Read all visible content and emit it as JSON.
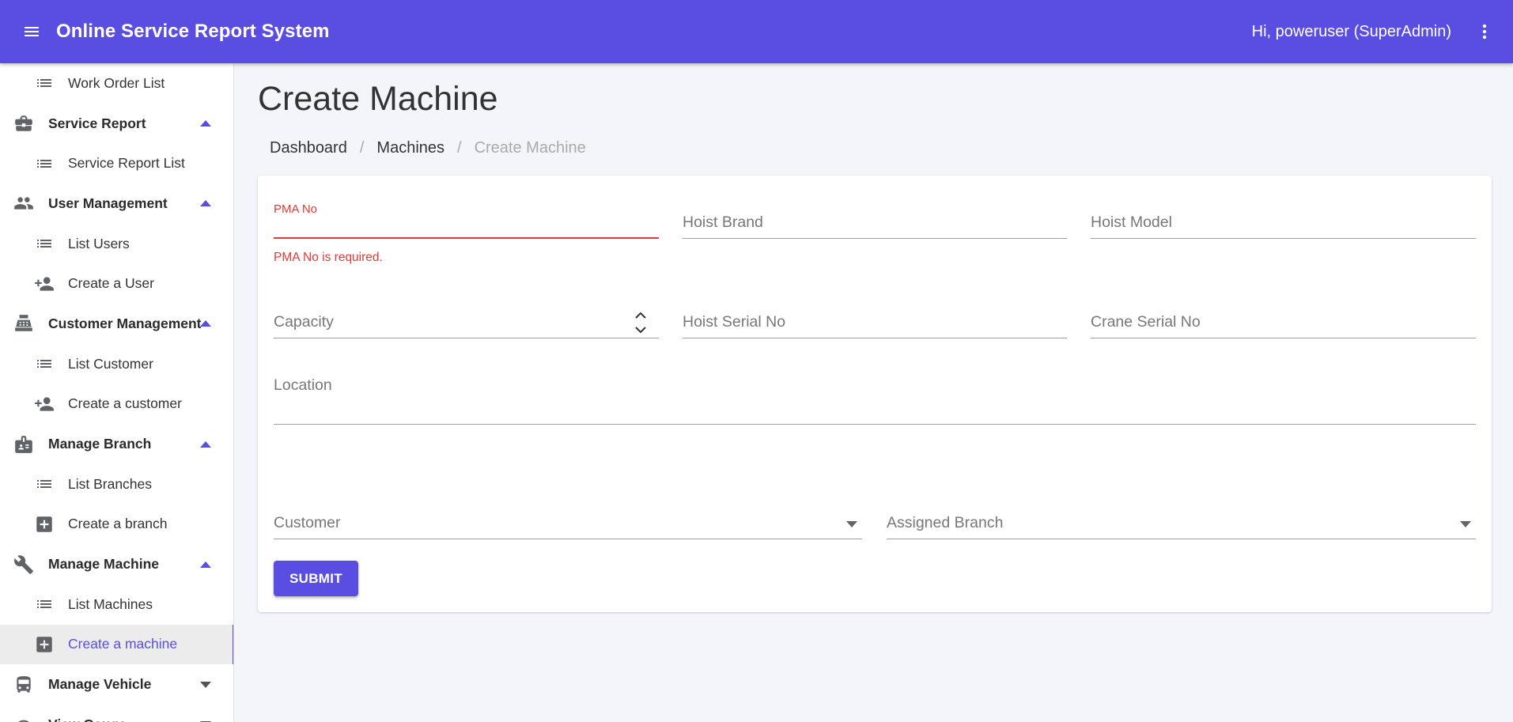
{
  "app": {
    "title": "Online Service Report System",
    "greeting": "Hi, poweruser (SuperAdmin)",
    "accent_color": "#5a4ee2",
    "error_color": "#e53935"
  },
  "sidebar": {
    "items": [
      {
        "type": "sub",
        "label": "Work Order List",
        "icon": "list-icon"
      },
      {
        "type": "group",
        "label": "Service Report",
        "icon": "briefcase-icon",
        "expanded": true
      },
      {
        "type": "sub",
        "label": "Service Report List",
        "icon": "list-icon"
      },
      {
        "type": "group",
        "label": "User Management",
        "icon": "people-icon",
        "expanded": true
      },
      {
        "type": "sub",
        "label": "List Users",
        "icon": "list-icon"
      },
      {
        "type": "sub",
        "label": "Create a User",
        "icon": "person-add-icon"
      },
      {
        "type": "group",
        "label": "Customer Management",
        "icon": "cash-register-icon",
        "expanded": true
      },
      {
        "type": "sub",
        "label": "List Customer",
        "icon": "list-icon"
      },
      {
        "type": "sub",
        "label": "Create a customer",
        "icon": "person-add-icon"
      },
      {
        "type": "group",
        "label": "Manage Branch",
        "icon": "badge-icon",
        "expanded": true
      },
      {
        "type": "sub",
        "label": "List Branches",
        "icon": "list-icon"
      },
      {
        "type": "sub",
        "label": "Create a branch",
        "icon": "add-box-icon"
      },
      {
        "type": "group",
        "label": "Manage Machine",
        "icon": "wrench-icon",
        "expanded": true
      },
      {
        "type": "sub",
        "label": "List Machines",
        "icon": "list-icon"
      },
      {
        "type": "sub",
        "label": "Create a machine",
        "icon": "add-box-icon",
        "active": true
      },
      {
        "type": "group",
        "label": "Manage Vehicle",
        "icon": "bus-icon",
        "expanded": false
      },
      {
        "type": "group",
        "label": "View Gauge",
        "icon": "gauge-icon",
        "expanded": false
      }
    ]
  },
  "page": {
    "title": "Create Machine",
    "breadcrumb": {
      "dashboard": "Dashboard",
      "machines": "Machines",
      "current": "Create Machine",
      "separator": "/"
    }
  },
  "form": {
    "pma_no": {
      "label": "PMA No",
      "value": "",
      "error": "PMA No is required."
    },
    "hoist_brand": {
      "label": "Hoist Brand",
      "value": ""
    },
    "hoist_model": {
      "label": "Hoist Model",
      "value": ""
    },
    "capacity": {
      "label": "Capacity",
      "value": ""
    },
    "hoist_serial_no": {
      "label": "Hoist Serial No",
      "value": ""
    },
    "crane_serial_no": {
      "label": "Crane Serial No",
      "value": ""
    },
    "location": {
      "label": "Location",
      "value": ""
    },
    "customer": {
      "label": "Customer",
      "value": ""
    },
    "assigned_branch": {
      "label": "Assigned Branch",
      "value": ""
    },
    "submit_label": "SUBMIT"
  }
}
